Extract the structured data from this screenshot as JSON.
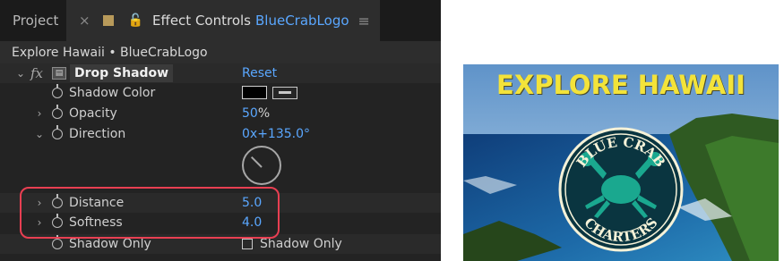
{
  "tabs": {
    "project": "Project",
    "close_symbol": "×",
    "effect_controls": "Effect Controls",
    "comp_name": "BlueCrabLogo",
    "menu_symbol": "≡"
  },
  "subheader": "Explore Hawaii • BlueCrabLogo",
  "effect": {
    "fx_label": "fx",
    "name": "Drop Shadow",
    "reset": "Reset"
  },
  "properties": [
    {
      "label": "Shadow Color",
      "value": ""
    },
    {
      "label": "Opacity",
      "value": "50",
      "unit": "%"
    },
    {
      "label": "Direction",
      "value": "0x+135.0°"
    },
    {
      "label": "Distance",
      "value": "5.0"
    },
    {
      "label": "Softness",
      "value": "4.0"
    },
    {
      "label": "Shadow Only",
      "value": "Shadow Only"
    }
  ],
  "icons": {
    "twirl_open": "⌄",
    "twirl_closed": "›"
  },
  "preview": {
    "headline": "EXPLORE HAWAII",
    "logo_top": "BLUE CRAB",
    "logo_bottom": "CHARTERS"
  },
  "colors": {
    "accent_blue": "#5aa7ff",
    "highlight_red": "#e83f52",
    "headline_yellow": "#f3e33a",
    "logo_teal": "#1aa88f"
  }
}
